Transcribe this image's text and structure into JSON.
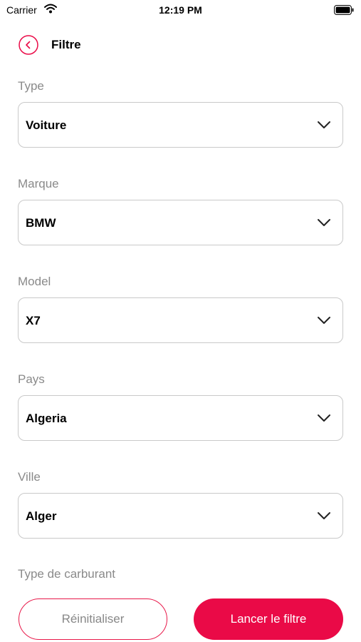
{
  "status_bar": {
    "carrier": "Carrier",
    "time": "12:19 PM"
  },
  "header": {
    "title": "Filtre"
  },
  "fields": [
    {
      "label": "Type",
      "value": "Voiture"
    },
    {
      "label": "Marque",
      "value": "BMW"
    },
    {
      "label": "Model",
      "value": "X7"
    },
    {
      "label": "Pays",
      "value": "Algeria"
    },
    {
      "label": "Ville",
      "value": "Alger"
    }
  ],
  "fuel": {
    "label": "Type de carburant"
  },
  "buttons": {
    "reset": "Réinitialiser",
    "apply": "Lancer le filtre"
  },
  "colors": {
    "accent": "#ea0a47",
    "label_gray": "#8a8a8a",
    "border": "#c9c9c9"
  }
}
